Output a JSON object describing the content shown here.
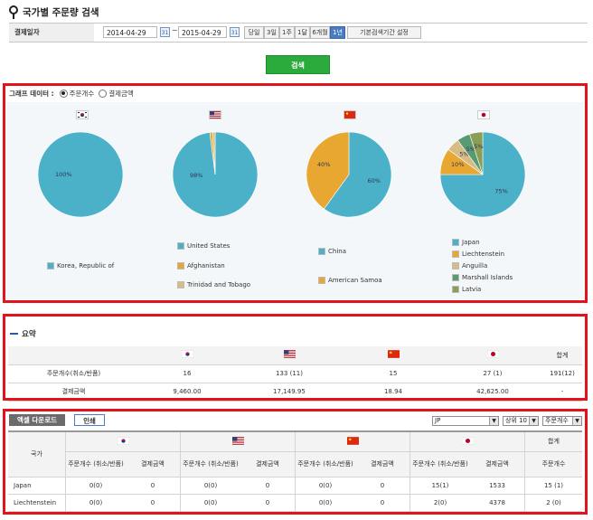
{
  "header": {
    "title": "국가별 주문량 검색"
  },
  "filter": {
    "label": "결제일자",
    "start_date": "2014-04-29",
    "end_date": "2015-04-29",
    "cal_icon": "31",
    "separator": "~",
    "periods": [
      "당일",
      "3일",
      "1주",
      "1달",
      "6개월",
      "1년"
    ],
    "active_period": "1년",
    "default_setting": "기본검색기간 설정",
    "search_label": "검색"
  },
  "graph": {
    "label": "그래프 데이터 :",
    "options": [
      "주문개수",
      "결제금액"
    ],
    "selected": "주문개수",
    "charts": [
      {
        "country": "KR",
        "slices": [
          {
            "label": "Korea, Republic of",
            "value": 100,
            "color": "#4ab1c8",
            "pct_text": "100%"
          }
        ]
      },
      {
        "country": "US",
        "slices": [
          {
            "label": "United States",
            "value": 98,
            "color": "#4ab1c8",
            "pct_text": "98%"
          },
          {
            "label": "Afghanistan",
            "value": 1,
            "color": "#e8a731",
            "pct_text": ""
          },
          {
            "label": "Trinidad and Tobago",
            "value": 1,
            "color": "#d7bd85",
            "pct_text": ""
          }
        ]
      },
      {
        "country": "CN",
        "slices": [
          {
            "label": "China",
            "value": 60,
            "color": "#4ab1c8",
            "pct_text": "60%"
          },
          {
            "label": "American Samoa",
            "value": 40,
            "color": "#e8a731",
            "pct_text": "40%"
          }
        ]
      },
      {
        "country": "JP",
        "slices": [
          {
            "label": "Japan",
            "value": 75,
            "color": "#4ab1c8",
            "pct_text": "75%"
          },
          {
            "label": "Liechtenstein",
            "value": 10,
            "color": "#e8a731",
            "pct_text": "10%"
          },
          {
            "label": "Anguilla",
            "value": 5,
            "color": "#d7bd85",
            "pct_text": "5%"
          },
          {
            "label": "Marshall Islands",
            "value": 5,
            "color": "#5a9a73",
            "pct_text": "5%"
          },
          {
            "label": "Latvia",
            "value": 5,
            "color": "#8c9e55",
            "pct_text": "5%"
          }
        ]
      }
    ]
  },
  "summary": {
    "title": "요약",
    "total_header": "합계",
    "rows": [
      {
        "label": "주문개수(취소/반품)",
        "values": [
          "16",
          "133 (11)",
          "15",
          "27 (1)",
          "191(12)"
        ]
      },
      {
        "label": "결제금액",
        "values": [
          "9,460.00",
          "17,149.95",
          "18.94",
          "42,625.00",
          "-"
        ]
      }
    ]
  },
  "detail": {
    "excel_label": "엑셀 다운로드",
    "print_label": "인쇄",
    "country_select": "JP",
    "top_select": "상위 10",
    "sort_select": "주문개수",
    "country_header": "국가",
    "total_header": "합계",
    "sub_headers": [
      "주문개수 (취소/반품)",
      "결제금액"
    ],
    "total_sub": "주문개수",
    "rows": [
      {
        "country": "Japan",
        "values": [
          "0(0)",
          "0",
          "0(0)",
          "0",
          "0(0)",
          "0",
          "15(1)",
          "1533",
          "15 (1)"
        ]
      },
      {
        "country": "Liechtenstein",
        "values": [
          "0(0)",
          "0",
          "0(0)",
          "0",
          "0(0)",
          "0",
          "2(0)",
          "4378",
          "2 (0)"
        ]
      }
    ]
  }
}
